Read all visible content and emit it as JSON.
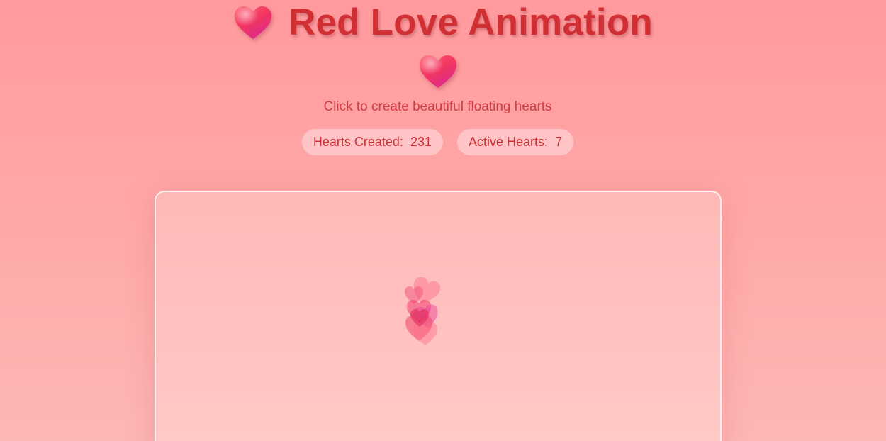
{
  "header": {
    "title": "Red Love Animation",
    "title_icon": "heart-icon",
    "center_icon": "heart-icon",
    "subtitle": "Click to create beautiful floating hearts"
  },
  "stats": {
    "hearts_created_label": "Hearts Created:",
    "hearts_created_value": "231",
    "active_hearts_label": "Active Hearts:",
    "active_hearts_value": "7"
  },
  "colors": {
    "background_top": "#ff9a9e",
    "background_bottom": "#fdb7b5",
    "title_color": "#d03033",
    "heart_gradient_start": "#ff4d6d",
    "heart_gradient_end": "#e0288a",
    "canvas_background": "#ffc0bf"
  }
}
